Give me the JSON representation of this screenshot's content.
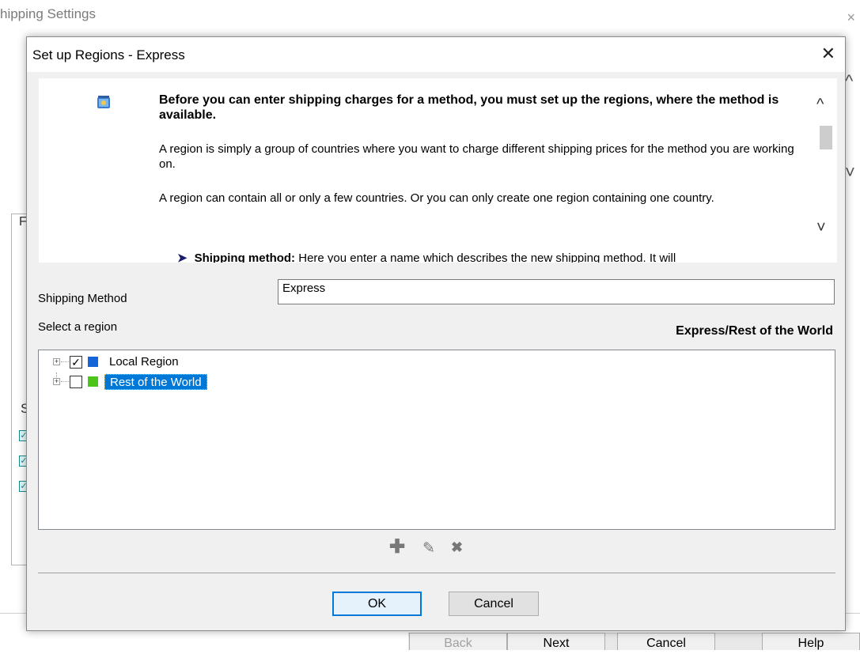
{
  "background_window": {
    "title": "hipping Settings",
    "close_glyph": "×",
    "scroll_up_glyph": "^",
    "scroll_down_glyph": "˅",
    "side_glyph_top": "F",
    "side_glyph_mid": "S",
    "buttons": {
      "back": "Back",
      "next": "Next",
      "cancel": "Cancel",
      "help": "Help"
    },
    "check_color": "#158c8c"
  },
  "dialog": {
    "title": "Set up Regions - Express",
    "close_glyph": "✕",
    "help": {
      "icon": "settings-app-icon",
      "heading": "Before you can enter shipping charges for a method, you must set up the regions, where the method is available.",
      "paragraphs": [
        "A region is simply a group of countries where you want to charge different shipping prices for the method you are working on.",
        "A region can contain all or only a few countries. Or you can only create one region containing one country."
      ],
      "bullet_term": "Shipping method:",
      "bullet_text": " Here you enter a name which describes the new shipping method. It will",
      "scroll_up_glyph": "^",
      "scroll_down_glyph": "˅"
    },
    "shipping_method_label": "Shipping Method",
    "shipping_method_value": "Express",
    "select_region_label": "Select a region",
    "selected_region_path": "Express/Rest of the World",
    "regions": [
      {
        "label": "Local Region",
        "checked": "✓",
        "color": "#1565d8"
      },
      {
        "label": "Rest of the World",
        "checked": "",
        "color": "#4cc41a",
        "selected": true
      }
    ],
    "tree_expander_glyph": "+",
    "toolbar": {
      "add_glyph": "✚",
      "edit_glyph": "✎",
      "delete_glyph": "✖"
    },
    "ok_label": "OK",
    "cancel_label": "Cancel",
    "colors": {
      "accent": "#0078d7",
      "selection": "#0078d7"
    }
  }
}
